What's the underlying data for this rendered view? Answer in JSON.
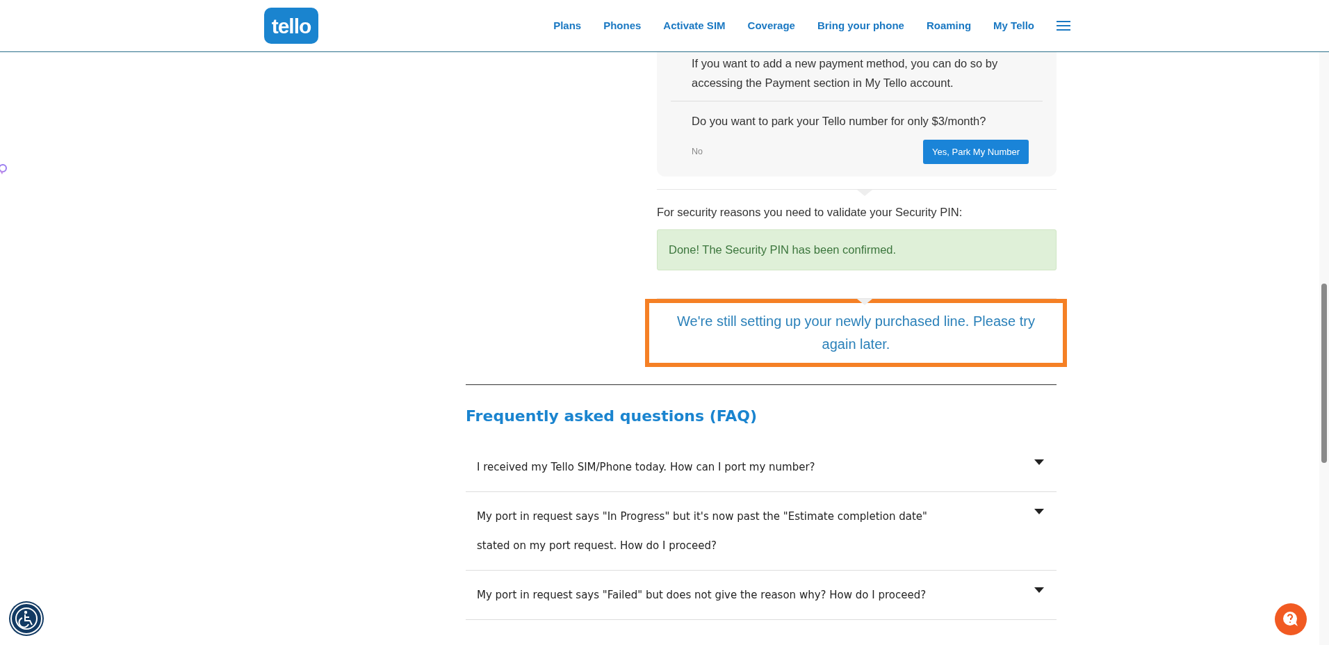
{
  "logo": "tello",
  "nav": [
    {
      "label": "Plans"
    },
    {
      "label": "Phones"
    },
    {
      "label": "Activate SIM"
    },
    {
      "label": "Coverage"
    },
    {
      "label": "Bring your phone"
    },
    {
      "label": "Roaming"
    },
    {
      "label": "My Tello"
    }
  ],
  "payment_card": {
    "note": "If you want to add a new payment method, you can do so by accessing the Payment section in My Tello account.",
    "question": "Do you want to park your Tello number for only $3/month?",
    "buttons": [
      {
        "label": "No",
        "kind": "link"
      },
      {
        "label": "Yes, Park My Number",
        "kind": "primary"
      }
    ]
  },
  "security": {
    "prompt": "For security reasons you need to validate your Security PIN:",
    "alert": "Done! The Security PIN has been confirmed."
  },
  "notice": "We're still setting up your newly purchased line. Please try again later.",
  "faq": {
    "title": "Frequently asked questions (FAQ)",
    "items": [
      {
        "question": "I received my Tello SIM/Phone today. How can I port my number?",
        "expanded": false
      },
      {
        "question": "My port in request says \"In Progress\" but it's now past the \"Estimate completion date\" stated on my port request. How do I proceed?",
        "expanded": false
      },
      {
        "question": "My port in request says \"Failed\" but does not give the reason why? How do I proceed?",
        "expanded": false
      }
    ]
  }
}
